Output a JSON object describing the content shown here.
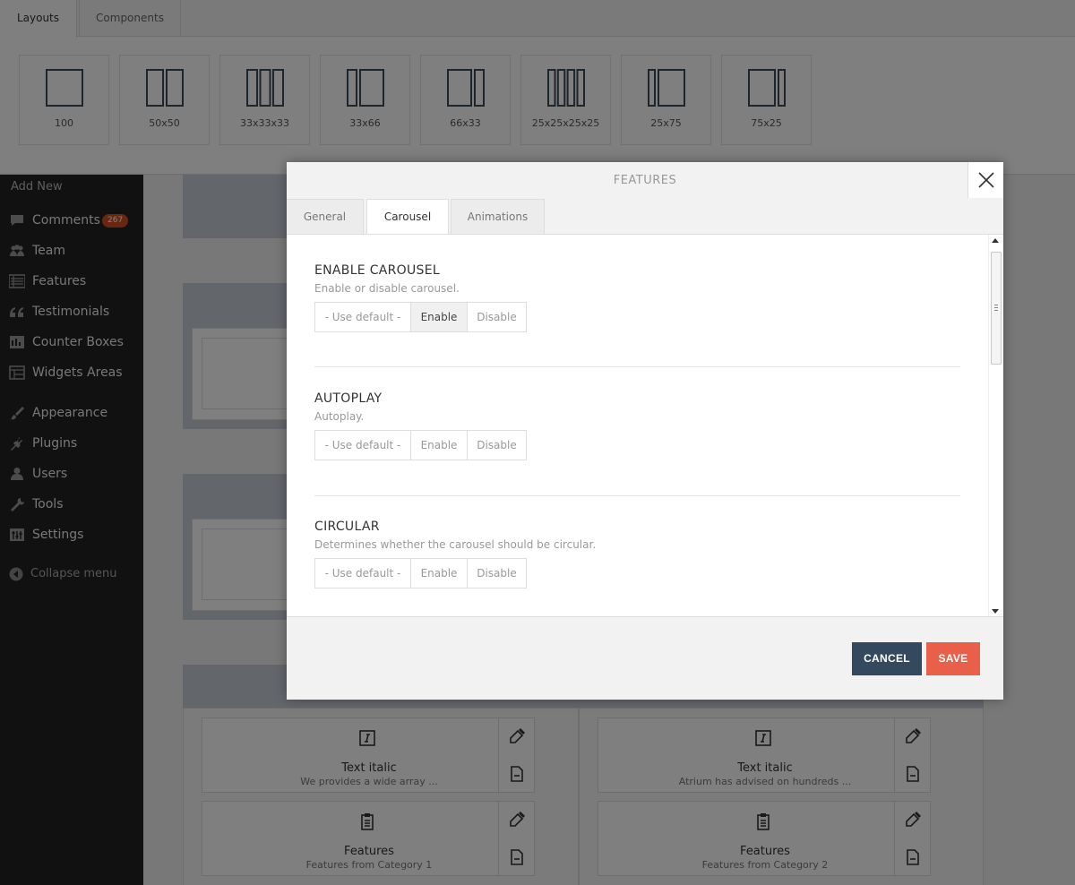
{
  "top_panel": {
    "tabs": [
      {
        "label": "Layouts",
        "active": true
      },
      {
        "label": "Components",
        "active": false
      }
    ],
    "layouts": [
      {
        "label": "100",
        "icon": "layout-100-icon"
      },
      {
        "label": "50x50",
        "icon": "layout-50x50-icon"
      },
      {
        "label": "33x33x33",
        "icon": "layout-33x33x33-icon"
      },
      {
        "label": "33x66",
        "icon": "layout-33x66-icon"
      },
      {
        "label": "66x33",
        "icon": "layout-66x33-icon"
      },
      {
        "label": "25x25x25x25",
        "icon": "layout-25x25x25x25-icon"
      },
      {
        "label": "25x75",
        "icon": "layout-25x75-icon"
      },
      {
        "label": "75x25",
        "icon": "layout-75x25-icon"
      }
    ]
  },
  "sidebar": {
    "add_new": "Add New",
    "items": [
      {
        "label": "Comments",
        "icon": "comment-icon",
        "badge": "267"
      },
      {
        "label": "Team",
        "icon": "team-icon"
      },
      {
        "label": "Features",
        "icon": "list-icon"
      },
      {
        "label": "Testimonials",
        "icon": "quote-icon"
      },
      {
        "label": "Counter Boxes",
        "icon": "counter-icon"
      },
      {
        "label": "Widgets Areas",
        "icon": "widgets-icon"
      },
      {
        "label": "Appearance",
        "icon": "brush-icon"
      },
      {
        "label": "Plugins",
        "icon": "plugin-icon"
      },
      {
        "label": "Users",
        "icon": "user-icon"
      },
      {
        "label": "Tools",
        "icon": "wrench-icon"
      },
      {
        "label": "Settings",
        "icon": "settings-icon"
      }
    ],
    "collapse": "Collapse menu"
  },
  "content": {
    "cards": [
      {
        "title": "Text italic",
        "desc": "We provides a wide array ...",
        "icon": "italic-icon"
      },
      {
        "title": "Text italic",
        "desc": "Atrium has advised on hundreds ...",
        "icon": "italic-icon"
      },
      {
        "title": "Features",
        "desc": "Features from Category 1",
        "icon": "clipboard-icon"
      },
      {
        "title": "Features",
        "desc": "Features from Category 2",
        "icon": "clipboard-icon"
      }
    ]
  },
  "modal": {
    "title": "FEATURES",
    "tabs": [
      {
        "label": "General",
        "active": false
      },
      {
        "label": "Carousel",
        "active": true
      },
      {
        "label": "Animations",
        "active": false
      }
    ],
    "settings": [
      {
        "title": "ENABLE CAROUSEL",
        "desc": "Enable or disable carousel.",
        "options": [
          "- Use default -",
          "Enable",
          "Disable"
        ],
        "selected": "Enable"
      },
      {
        "title": "AUTOPLAY",
        "desc": "Autoplay.",
        "options": [
          "- Use default -",
          "Enable",
          "Disable"
        ],
        "selected": ""
      },
      {
        "title": "CIRCULAR",
        "desc": "Determines whether the carousel should be circular.",
        "options": [
          "- Use default -",
          "Enable",
          "Disable"
        ],
        "selected": ""
      }
    ],
    "cancel_label": "CANCEL",
    "save_label": "SAVE"
  },
  "colors": {
    "sidebar_bg": "#222222",
    "badge": "#d54e21",
    "cancel": "#34495e",
    "save": "#e9604a"
  }
}
